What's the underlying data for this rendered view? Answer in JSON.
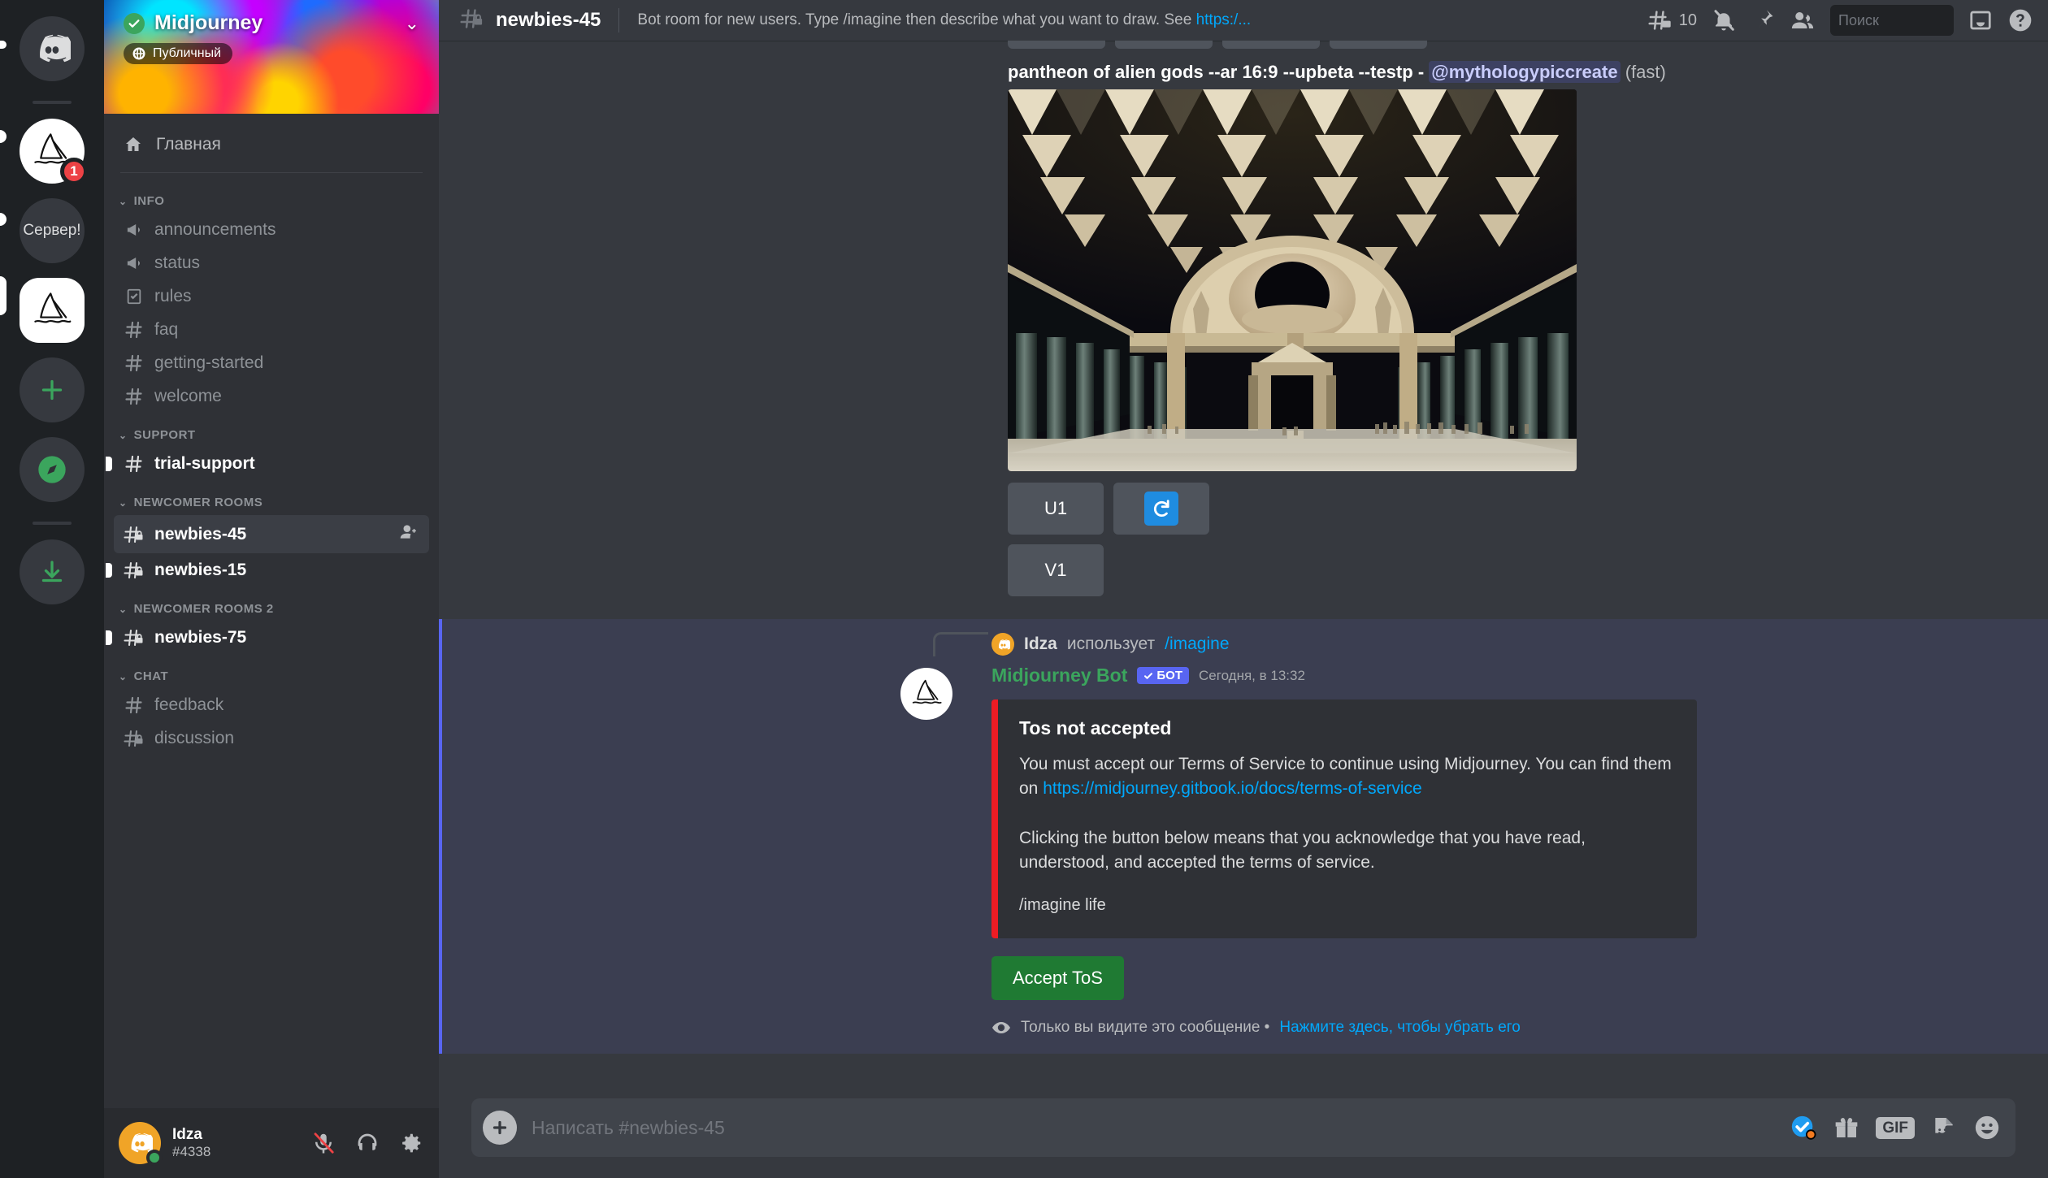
{
  "rail": {
    "items": [
      {
        "name": "discord-home",
        "type": "discord",
        "badge": null,
        "active": false
      },
      {
        "name": "midjourney-server",
        "type": "sail",
        "badge": "1",
        "active": false
      },
      {
        "name": "server-folder",
        "type": "text",
        "label": "Сервер!",
        "badge": null,
        "active": false
      },
      {
        "name": "midjourney-server-selected",
        "type": "sail",
        "badge": null,
        "active": true
      },
      {
        "name": "add-server",
        "type": "plus",
        "badge": null,
        "active": false
      },
      {
        "name": "explore-servers",
        "type": "compass",
        "badge": null,
        "active": false
      },
      {
        "name": "download-apps",
        "type": "download",
        "badge": null,
        "active": false
      }
    ]
  },
  "sidebar": {
    "server_name": "Midjourney",
    "public_label": "Публичный",
    "home_label": "Главная",
    "categories": [
      {
        "label": "INFO",
        "channels": [
          {
            "name": "announcements",
            "icon": "announcement-icon",
            "state": "read",
            "unread_dot": false
          },
          {
            "name": "status",
            "icon": "announcement-icon",
            "state": "read",
            "unread_dot": false
          },
          {
            "name": "rules",
            "icon": "rules-icon",
            "state": "read",
            "unread_dot": false
          },
          {
            "name": "faq",
            "icon": "hash-icon",
            "state": "read",
            "unread_dot": false
          },
          {
            "name": "getting-started",
            "icon": "hash-icon",
            "state": "read",
            "unread_dot": false
          },
          {
            "name": "welcome",
            "icon": "hash-icon",
            "state": "read",
            "unread_dot": false
          }
        ]
      },
      {
        "label": "SUPPORT",
        "channels": [
          {
            "name": "trial-support",
            "icon": "hash-icon",
            "state": "unread",
            "unread_dot": true
          }
        ]
      },
      {
        "label": "NEWCOMER ROOMS",
        "channels": [
          {
            "name": "newbies-45",
            "icon": "hash-lock-icon",
            "state": "active",
            "unread_dot": false,
            "trailing_icon": "add-member-icon"
          },
          {
            "name": "newbies-15",
            "icon": "hash-lock-icon",
            "state": "unread",
            "unread_dot": true
          }
        ]
      },
      {
        "label": "NEWCOMER ROOMS 2",
        "channels": [
          {
            "name": "newbies-75",
            "icon": "hash-lock-icon",
            "state": "unread",
            "unread_dot": true
          }
        ]
      },
      {
        "label": "CHAT",
        "channels": [
          {
            "name": "feedback",
            "icon": "hash-icon",
            "state": "read",
            "unread_dot": false
          },
          {
            "name": "discussion",
            "icon": "hash-lock-icon",
            "state": "read",
            "unread_dot": false
          }
        ]
      }
    ]
  },
  "user_panel": {
    "username": "Idza",
    "discriminator": "#4338",
    "status": "online",
    "buttons": [
      "mute-icon",
      "deafen-icon",
      "settings-icon"
    ]
  },
  "topbar": {
    "channel_name": "newbies-45",
    "topic_prefix": "Bot room for new users. Type /imagine then describe what you want to draw. See ",
    "topic_link": "https:/...",
    "threads_count": "10",
    "icons": [
      "threads-icon",
      "notifications-off-icon",
      "pinned-messages-icon",
      "member-list-icon",
      "inbox-icon",
      "help-icon"
    ]
  },
  "search": {
    "placeholder": "Поиск",
    "value": ""
  },
  "messages": {
    "generation": {
      "prompt": "pantheon of alien gods --ar 16:9 --upbeta --testp",
      "dash": "-",
      "mention": "@mythologypiccreate",
      "speed": "(fast)",
      "buttons_row1": [
        "U1",
        "refresh-icon"
      ],
      "buttons_row2": [
        "V1"
      ]
    },
    "tos": {
      "reply_user": "Idza",
      "reply_action": "использует",
      "reply_command": "/imagine",
      "bot_name": "Midjourney Bot",
      "bot_tag": "БОТ",
      "timestamp": "Сегодня, в 13:32",
      "embed_title": "Tos not accepted",
      "embed_p1_before": "You must accept our Terms of Service to continue using Midjourney. You can find them on ",
      "embed_p1_link": "https://midjourney.gitbook.io/docs/terms-of-service",
      "embed_p2": "Clicking the button below means that you acknowledge that you have read, understood, and accepted the terms of service.",
      "embed_p3": "/imagine life",
      "accept_button": "Accept ToS",
      "ephemeral_text": "Только вы видите это сообщение •",
      "ephemeral_link": "Нажмите здесь, чтобы убрать его"
    }
  },
  "composer": {
    "placeholder": "Написать #newbies-45",
    "value": "",
    "icons": [
      "nitro-gift-icon",
      "gift-icon",
      "gif-icon",
      "sticker-icon",
      "emoji-icon"
    ],
    "gif_label": "GIF"
  },
  "colors": {
    "accent": "#5865f2",
    "online": "#3ba55d",
    "danger": "#ed1c24",
    "link": "#00a8fc",
    "accept": "#1f7a33",
    "badge": "#ed4245"
  }
}
